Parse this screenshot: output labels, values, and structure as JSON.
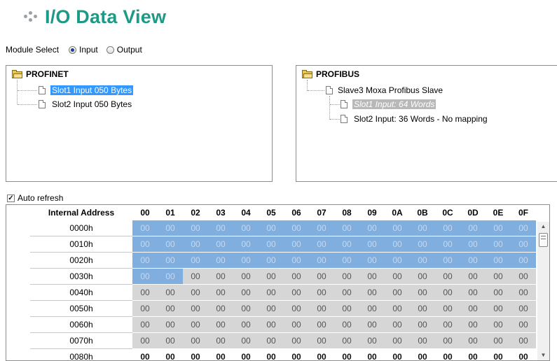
{
  "page": {
    "title": "I/O Data View"
  },
  "module_select": {
    "label": "Module Select",
    "options": [
      "Input",
      "Output"
    ],
    "selected": "Input"
  },
  "left_tree": {
    "root": "PROFINET",
    "items": [
      {
        "label": "Slot1 Input 050 Bytes",
        "selected": true
      },
      {
        "label": "Slot2 Input 050 Bytes",
        "selected": false
      }
    ]
  },
  "right_tree": {
    "root": "PROFIBUS",
    "slave": "Slave3 Moxa Profibus Slave",
    "items": [
      {
        "label": "Slot1 Input: 64 Words",
        "selected": true
      },
      {
        "label": "Slot2 Input: 36 Words - No mapping",
        "selected": false
      }
    ]
  },
  "auto_refresh": {
    "label": "Auto refresh",
    "checked": true
  },
  "grid": {
    "header_address": "Internal Address",
    "columns": [
      "00",
      "01",
      "02",
      "03",
      "04",
      "05",
      "06",
      "07",
      "08",
      "09",
      "0A",
      "0B",
      "0C",
      "0D",
      "0E",
      "0F"
    ],
    "rows": [
      {
        "address": "0000h",
        "values": [
          "00",
          "00",
          "00",
          "00",
          "00",
          "00",
          "00",
          "00",
          "00",
          "00",
          "00",
          "00",
          "00",
          "00",
          "00",
          "00"
        ]
      },
      {
        "address": "0010h",
        "values": [
          "00",
          "00",
          "00",
          "00",
          "00",
          "00",
          "00",
          "00",
          "00",
          "00",
          "00",
          "00",
          "00",
          "00",
          "00",
          "00"
        ]
      },
      {
        "address": "0020h",
        "values": [
          "00",
          "00",
          "00",
          "00",
          "00",
          "00",
          "00",
          "00",
          "00",
          "00",
          "00",
          "00",
          "00",
          "00",
          "00",
          "00"
        ]
      },
      {
        "address": "0030h",
        "values": [
          "00",
          "00",
          "00",
          "00",
          "00",
          "00",
          "00",
          "00",
          "00",
          "00",
          "00",
          "00",
          "00",
          "00",
          "00",
          "00"
        ]
      },
      {
        "address": "0040h",
        "values": [
          "00",
          "00",
          "00",
          "00",
          "00",
          "00",
          "00",
          "00",
          "00",
          "00",
          "00",
          "00",
          "00",
          "00",
          "00",
          "00"
        ]
      },
      {
        "address": "0050h",
        "values": [
          "00",
          "00",
          "00",
          "00",
          "00",
          "00",
          "00",
          "00",
          "00",
          "00",
          "00",
          "00",
          "00",
          "00",
          "00",
          "00"
        ]
      },
      {
        "address": "0060h",
        "values": [
          "00",
          "00",
          "00",
          "00",
          "00",
          "00",
          "00",
          "00",
          "00",
          "00",
          "00",
          "00",
          "00",
          "00",
          "00",
          "00"
        ]
      },
      {
        "address": "0070h",
        "values": [
          "00",
          "00",
          "00",
          "00",
          "00",
          "00",
          "00",
          "00",
          "00",
          "00",
          "00",
          "00",
          "00",
          "00",
          "00",
          "00"
        ]
      },
      {
        "address": "0080h",
        "values": [
          "00",
          "00",
          "00",
          "00",
          "00",
          "00",
          "00",
          "00",
          "00",
          "00",
          "00",
          "00",
          "00",
          "00",
          "00",
          "00"
        ]
      }
    ],
    "mapped_cells": 50,
    "colors": {
      "mapped": "#80aede",
      "unmapped": "#d6d6d6"
    }
  },
  "colors": {
    "title": "#1d9a86",
    "selection": "#3399ff"
  }
}
